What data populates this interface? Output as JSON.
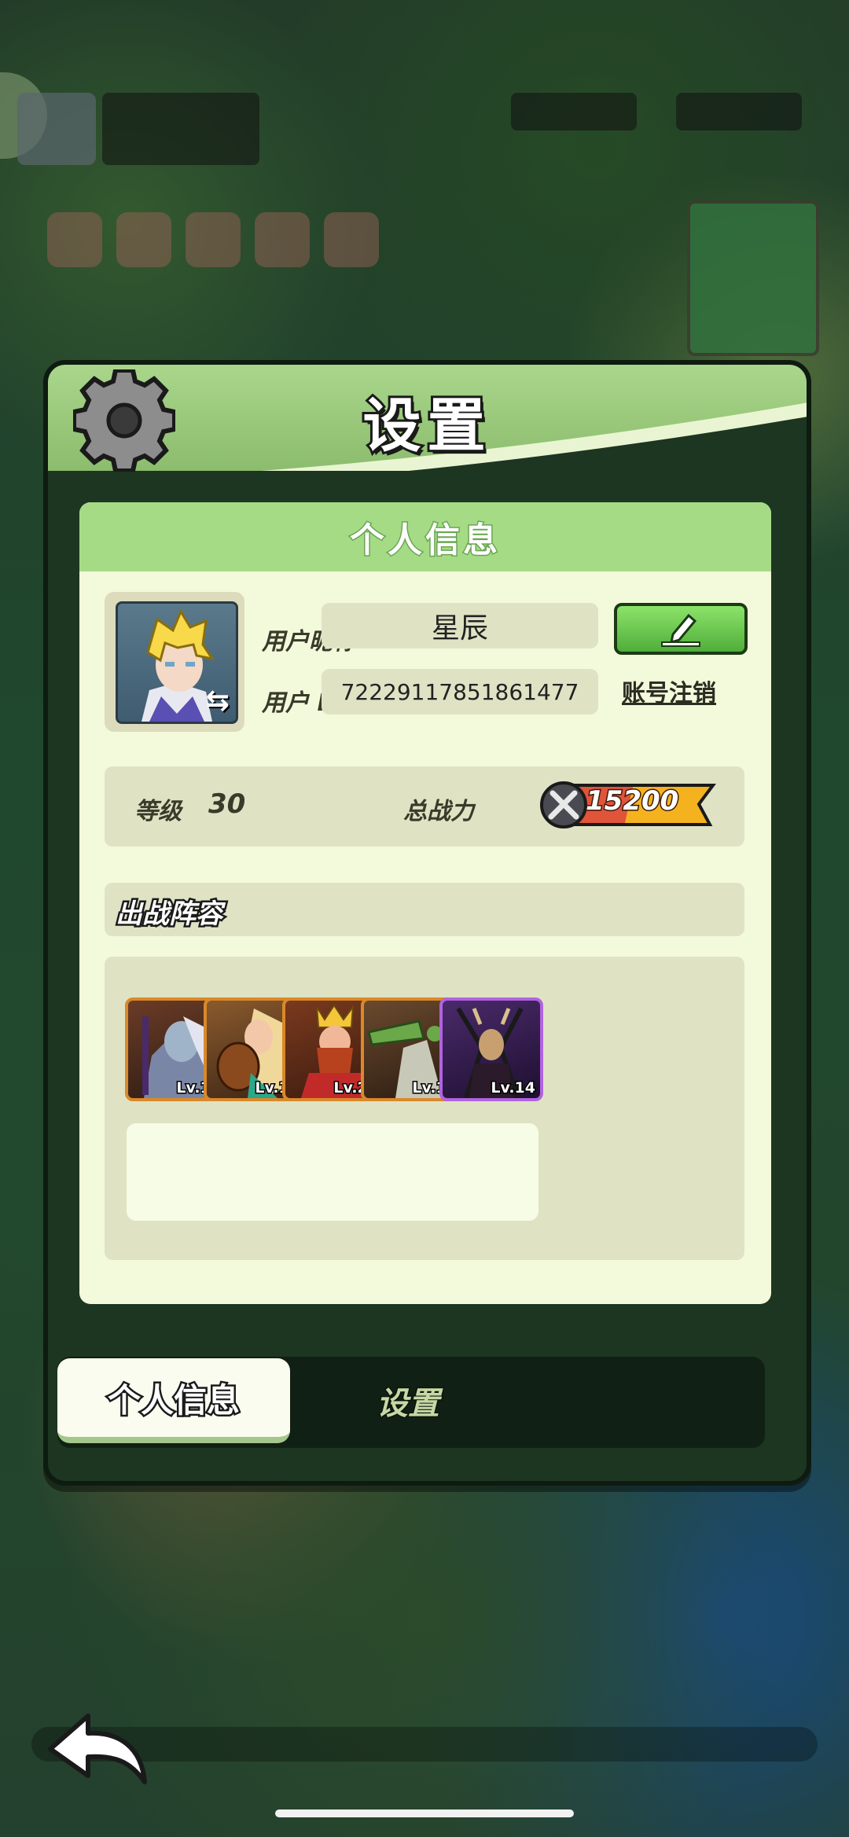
{
  "dialog": {
    "title": "设置",
    "icon": "gear-icon"
  },
  "profile": {
    "section_title": "个人信息",
    "nickname_label": "用户昵称",
    "nickname": "星辰",
    "id_label": "用户 ID",
    "user_id": "72229117851861477",
    "edit_icon": "pencil-icon",
    "cancel_account": "账号注销",
    "level_label": "等级",
    "level": "30",
    "power_label": "总战力",
    "power": "15200"
  },
  "lineup": {
    "title": "出战阵容",
    "heroes": [
      {
        "level": "Lv.10",
        "frame": "orange"
      },
      {
        "level": "Lv.14",
        "frame": "orange"
      },
      {
        "level": "Lv.20",
        "frame": "orange"
      },
      {
        "level": "Lv.14",
        "frame": "orange"
      },
      {
        "level": "Lv.14",
        "frame": "purple"
      }
    ],
    "empty_slots": 5
  },
  "tabs": {
    "active": "个人信息",
    "inactive": "设置"
  },
  "colors": {
    "header_green": "#a9d68b",
    "panel_bg": "#f3fadb",
    "orange_frame": "#d9892a",
    "purple_frame": "#b163e0",
    "power_badge": "#f5b21f"
  }
}
